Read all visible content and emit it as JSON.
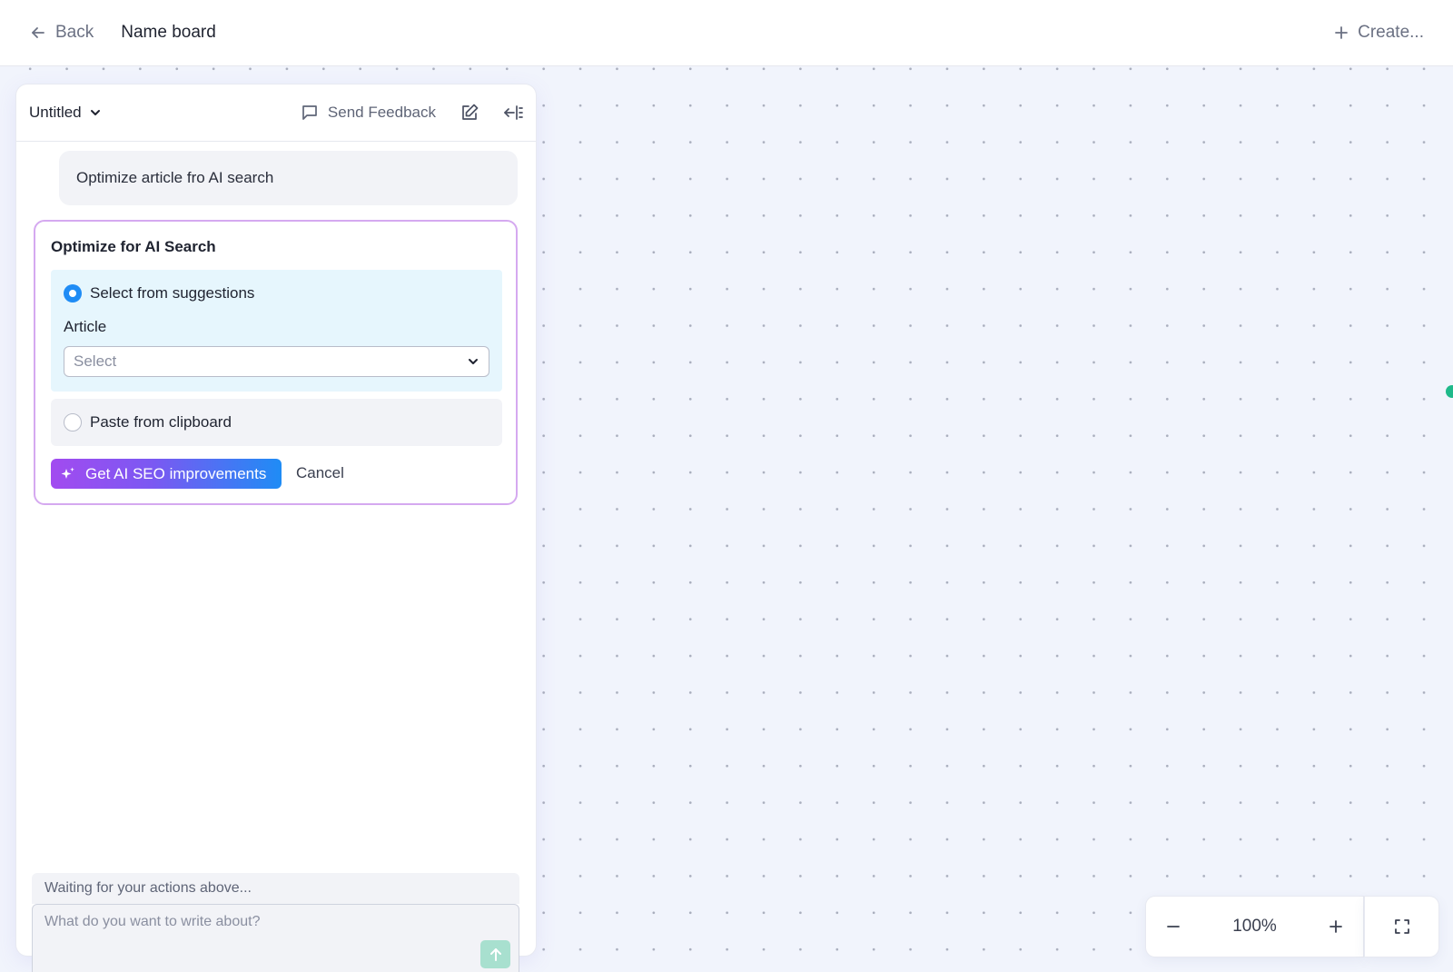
{
  "topbar": {
    "back_label": "Back",
    "board_name": "Name board",
    "create_label": "Create..."
  },
  "panel": {
    "document_title": "Untitled",
    "feedback_label": "Send Feedback",
    "user_message": "Optimize article fro AI search",
    "card": {
      "title": "Optimize for AI Search",
      "option_suggestions": "Select from suggestions",
      "article_label": "Article",
      "article_select_placeholder": "Select",
      "option_clipboard": "Paste from clipboard",
      "primary_button": "Get AI SEO improvements",
      "cancel_button": "Cancel",
      "selected_option": "suggestions"
    },
    "status_text": "Waiting for your actions above...",
    "compose_placeholder": "What do you want to write about?"
  },
  "zoom": {
    "level": "100%"
  },
  "icons": {
    "back": "arrow-left-icon",
    "create": "plus-icon",
    "doc_dropdown": "chevron-down-icon",
    "feedback": "message-square-icon",
    "edit": "edit-icon",
    "collapse": "collapse-panel-icon",
    "sparkle": "sparkle-icon",
    "send": "arrow-up-icon",
    "zoom_out": "minus-icon",
    "zoom_in": "plus-icon",
    "fullscreen": "fullscreen-icon"
  },
  "colors": {
    "canvas_background": "#f1f4fc",
    "accent_blue": "#1f8cf5",
    "accent_purple": "#a24bf0",
    "card_border": "#d5a9f0",
    "suggestion_bg": "#e6f6fd",
    "send_button": "#a8e0cf",
    "canvas_handle": "#1fb98a"
  }
}
